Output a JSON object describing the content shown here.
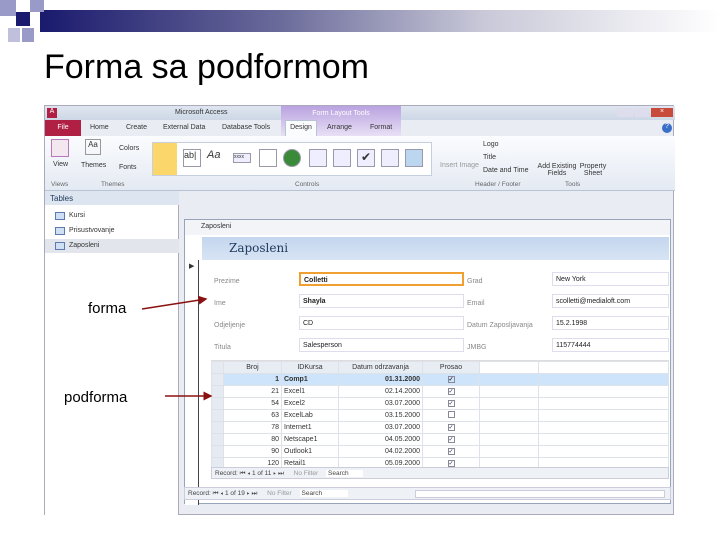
{
  "slide": {
    "title": "Forma sa podformom",
    "annotation_form": "forma",
    "annotation_subform": "podforma"
  },
  "app": {
    "title": "Microsoft Access",
    "context_tab": "Form Layout Tools",
    "tabs": [
      "File",
      "Home",
      "Create",
      "External Data",
      "Database Tools",
      "Design",
      "Arrange",
      "Format"
    ],
    "ribbon": {
      "view": "View",
      "themes": "Themes",
      "colors": "Colors",
      "fonts": "Fonts",
      "insert_image": "Insert Image",
      "logo": "Logo",
      "title": "Title",
      "date_time": "Date and Time",
      "add_fields": "Add Existing Fields",
      "property_sheet": "Property Sheet",
      "groups": [
        "Views",
        "Themes",
        "Controls",
        "Header / Footer",
        "Tools"
      ],
      "textbox_glyph": "ab|",
      "label_glyph": "Aa",
      "button_glyph": "xxxx"
    }
  },
  "nav": {
    "header": "Tables",
    "items": [
      "Kursi",
      "Prisustvovanje",
      "Zaposleni"
    ]
  },
  "form": {
    "window_title": "Zaposleni",
    "header": "Zaposleni",
    "fields": [
      {
        "label": "Prezime",
        "value": "Colletti"
      },
      {
        "label": "Ime",
        "value": "Shayla"
      },
      {
        "label": "Odjeljenje",
        "value": "CD"
      },
      {
        "label": "Titula",
        "value": "Salesperson"
      },
      {
        "label": "Grad",
        "value": "New York"
      },
      {
        "label": "Email",
        "value": "scolletti@medialoft.com"
      },
      {
        "label": "Datum Zaposljavanja",
        "value": "15.2.1998"
      },
      {
        "label": "JMBG",
        "value": "115774444"
      }
    ],
    "subform": {
      "columns": [
        "Broj",
        "IDKursa",
        "Datum odrzavanja",
        "Prosao"
      ],
      "rows": [
        [
          "1",
          "Comp1",
          "01.31.2000",
          true
        ],
        [
          "21",
          "Excel1",
          "02.14.2000",
          true
        ],
        [
          "54",
          "Excel2",
          "03.07.2000",
          true
        ],
        [
          "63",
          "ExcelLab",
          "03.15.2000",
          false
        ],
        [
          "78",
          "Internet1",
          "03.07.2000",
          true
        ],
        [
          "80",
          "Netscape1",
          "04.05.2000",
          true
        ],
        [
          "90",
          "Outlook1",
          "04.02.2000",
          true
        ],
        [
          "120",
          "Retail1",
          "05.09.2000",
          true
        ]
      ],
      "record_label": "Record:",
      "record_pos": "1 of 11",
      "filter": "No Filter",
      "search": "Search"
    },
    "record_label": "Record:",
    "record_pos": "1 of 19",
    "filter": "No Filter",
    "search": "Search"
  }
}
